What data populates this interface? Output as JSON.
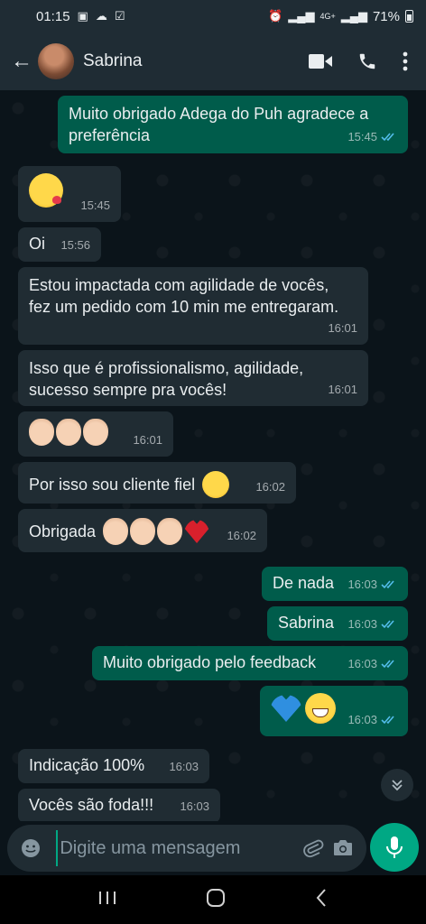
{
  "status_bar": {
    "time": "01:15",
    "network": "4G+",
    "battery": "71%"
  },
  "header": {
    "contact_name": "Sabrina"
  },
  "messages": [
    {
      "dir": "out",
      "text": "Muito obrigado Adega do Puh agradece a preferência",
      "time": "15:45"
    },
    {
      "dir": "in",
      "emoji": [
        "kiss"
      ],
      "time": "15:45"
    },
    {
      "dir": "in",
      "text": "Oi",
      "time": "15:56"
    },
    {
      "dir": "in",
      "text": "Estou impactada com agilidade de vocês, fez um pedido com 10 min me entregaram.",
      "time": "16:01"
    },
    {
      "dir": "in",
      "text": "Isso que é profissionalismo, agilidade, sucesso sempre pra vocês!",
      "time": "16:01"
    },
    {
      "dir": "in",
      "emoji": [
        "clap",
        "clap",
        "clap"
      ],
      "time": "16:01"
    },
    {
      "dir": "in",
      "text": "Por isso sou cliente fiel",
      "emoji": [
        "smile"
      ],
      "time": "16:02"
    },
    {
      "dir": "in",
      "text": "Obrigada",
      "emoji": [
        "clap",
        "clap",
        "clap",
        "heart"
      ],
      "time": "16:02"
    },
    {
      "dir": "out",
      "text": "De nada",
      "time": "16:03"
    },
    {
      "dir": "out",
      "text": "Sabrina",
      "time": "16:03"
    },
    {
      "dir": "out",
      "text": "Muito obrigado pelo feedback",
      "time": "16:03"
    },
    {
      "dir": "out",
      "emoji": [
        "blueheart",
        "grin"
      ],
      "time": "16:03"
    },
    {
      "dir": "in",
      "text": "Indicação 100%",
      "time": "16:03"
    },
    {
      "dir": "in",
      "text": "Vocês são foda!!!",
      "time": "16:03"
    }
  ],
  "composer": {
    "placeholder": "Digite uma mensagem"
  },
  "colors": {
    "incoming": "#202c33",
    "outgoing": "#005c4b",
    "accent": "#00a884",
    "read_ticks": "#53bdeb"
  }
}
